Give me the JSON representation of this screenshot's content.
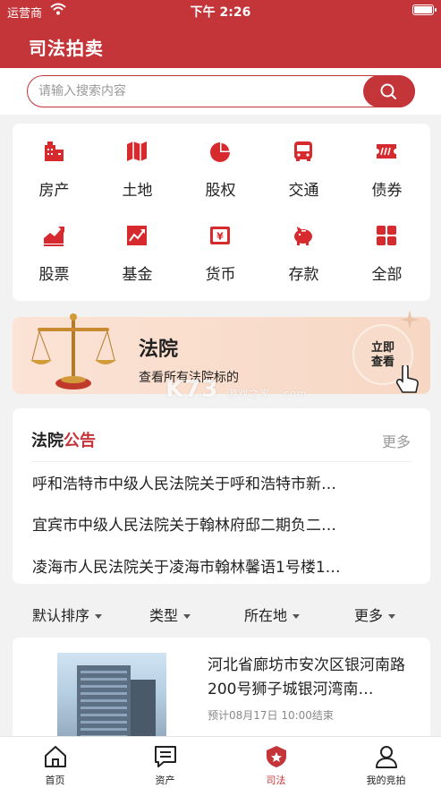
{
  "status_bar": {
    "carrier": "运营商",
    "time": "下午 2:26"
  },
  "header": {
    "title": "司法拍卖"
  },
  "search": {
    "placeholder": "请输入搜索内容"
  },
  "categories": [
    {
      "label": "房产",
      "icon": "building-icon"
    },
    {
      "label": "土地",
      "icon": "map-icon"
    },
    {
      "label": "股权",
      "icon": "pie-chart-icon"
    },
    {
      "label": "交通",
      "icon": "bus-icon"
    },
    {
      "label": "债券",
      "icon": "ticket-icon"
    },
    {
      "label": "股票",
      "icon": "stock-chart-icon"
    },
    {
      "label": "基金",
      "icon": "fund-chart-icon"
    },
    {
      "label": "货币",
      "icon": "yuan-note-icon"
    },
    {
      "label": "存款",
      "icon": "piggy-bank-icon"
    },
    {
      "label": "全部",
      "icon": "grid-icon"
    }
  ],
  "court_banner": {
    "title": "法院",
    "subtitle": "查看所有法院标的",
    "button_line1": "立即",
    "button_line2": "查看"
  },
  "notices": {
    "title_part1": "法院",
    "title_part2": "公告",
    "more": "更多",
    "items": [
      "呼和浩特市中级人民法院关于呼和浩特市新…",
      "宜宾市中级人民法院关于翰林府邸二期负二…",
      "凌海市人民法院关于凌海市翰林馨语1号楼1…"
    ]
  },
  "filters": [
    "默认排序",
    "类型",
    "所在地",
    "更多"
  ],
  "listing": {
    "title": "河北省廊坊市安次区银河南路200号狮子城银河湾南…",
    "date": "预计08月17日 10:00结束"
  },
  "tabs": [
    {
      "label": "首页",
      "icon": "home-icon"
    },
    {
      "label": "资产",
      "icon": "message-icon"
    },
    {
      "label": "司法",
      "icon": "badge-icon"
    },
    {
      "label": "我的竞拍",
      "icon": "user-icon"
    }
  ],
  "watermark": {
    "main": "K73",
    "sub": "游戏之家",
    "domain": ".com"
  },
  "colors": {
    "brand": "#c4353a",
    "background": "#f2f2f2"
  }
}
